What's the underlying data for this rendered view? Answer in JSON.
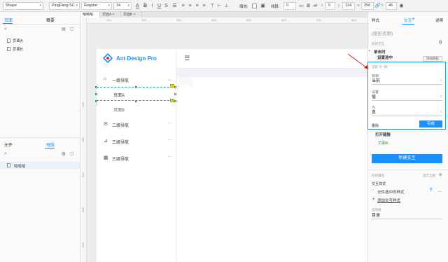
{
  "toolbar": {
    "shape_select": "Shape",
    "font_family": "PingFang SC",
    "font_weight": "Regular",
    "font_size": "14",
    "fill_label": "填充:",
    "line_label": "线段:",
    "line_width": "0",
    "x_value": "0",
    "y_value": "124",
    "w_value": "256",
    "h_value": "46"
  },
  "left_panel": {
    "tabs": [
      "页面",
      "概要"
    ],
    "pages": [
      "页面A",
      "页面B"
    ],
    "bottom_tabs": [
      "元件",
      "母版"
    ],
    "masters": [
      "哈哈哈"
    ]
  },
  "doc_tabs": [
    "哈哈哈",
    "页面A",
    "页面B"
  ],
  "ruler_top": [
    "100",
    "200",
    "300",
    "400",
    "500",
    "600",
    "700",
    "800"
  ],
  "ruler_left": [
    "100",
    "200",
    "300",
    "400",
    "500",
    "600"
  ],
  "canvas": {
    "brand": "Ant Design Pro",
    "menu": [
      {
        "label": "一级导航",
        "icon": "home-icon"
      },
      {
        "label": "二级导航",
        "icon": "mail-icon"
      },
      {
        "label": "三级导航",
        "icon": "chart-icon"
      },
      {
        "label": "三级导航",
        "icon": "table-icon"
      }
    ],
    "submenu": [
      "页面A",
      "页面B"
    ],
    "yellow_mark": "?"
  },
  "right_panel": {
    "tabs": [
      "样式",
      "交互",
      "说明"
    ],
    "shape_name_placeholder": "(矩形名称)",
    "shape_interaction_label": "形状交互",
    "event": "单击时",
    "action": "设置选中",
    "add_target": "添加目标",
    "target_hint": "当前 为 \"真\"",
    "target_label": "目标",
    "target_value": "当前",
    "set_label": "设置",
    "set_value": "值",
    "to_label": "为",
    "to_value": "真",
    "delete": "删除",
    "done": "完成",
    "open_link": "打开链接",
    "link_target": "页面A",
    "new_interaction": "新建交互",
    "shape_props_label": "形状属性",
    "show_all": "显示全部",
    "interaction_style_label": "交互样式",
    "selected_style": "元件选中的样式",
    "add_interaction_style": "添加交互样式",
    "option_group_label": "选项组",
    "option_group_value": "目录",
    "accent": "#1890ff"
  }
}
